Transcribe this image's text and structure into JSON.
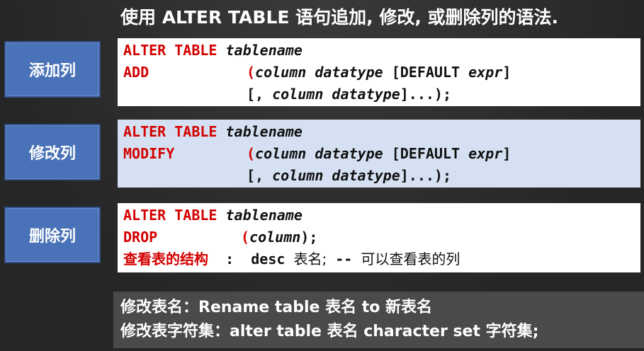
{
  "title": "使用 ALTER TABLE 语句追加, 修改, 或删除列的语法.",
  "add": {
    "label": "添加列",
    "l1_kw": "ALTER TABLE",
    "l1_name": "tablename",
    "l2_kw": "ADD",
    "l2_paren": "(",
    "l2_col": "column datatype",
    "l2_default": "[DEFAULT",
    "l2_expr": "expr",
    "l2_close": "]",
    "l3_pre": "[,",
    "l3_col": "column datatype",
    "l3_post": "]...);"
  },
  "modify": {
    "label": "修改列",
    "l1_kw": "ALTER TABLE",
    "l1_name": "tablename",
    "l2_kw": "MODIFY",
    "l2_paren": "(",
    "l2_col": "column datatype",
    "l2_default": "[DEFAULT",
    "l2_expr": "expr",
    "l2_close": "]",
    "l3_pre": "[,",
    "l3_col": "column datatype",
    "l3_post": "]...);"
  },
  "drop": {
    "label": "删除列",
    "l1_kw": "ALTER TABLE",
    "l1_name": "tablename",
    "l2_kw": "DROP",
    "l2_paren": "(",
    "l2_col": "column",
    "l2_post": ");",
    "l3_red": "查看表的结构",
    "l3_colon": ":",
    "l3_cmd": "desc",
    "l3_cjk1": "表名;",
    "l3_comment": "--",
    "l3_cjk2": "可以查看表的列"
  },
  "footer": {
    "line1": "修改表名：Rename table 表名 to 新表名",
    "line2": "修改表字符集：alter table 表名 character set 字符集;"
  }
}
